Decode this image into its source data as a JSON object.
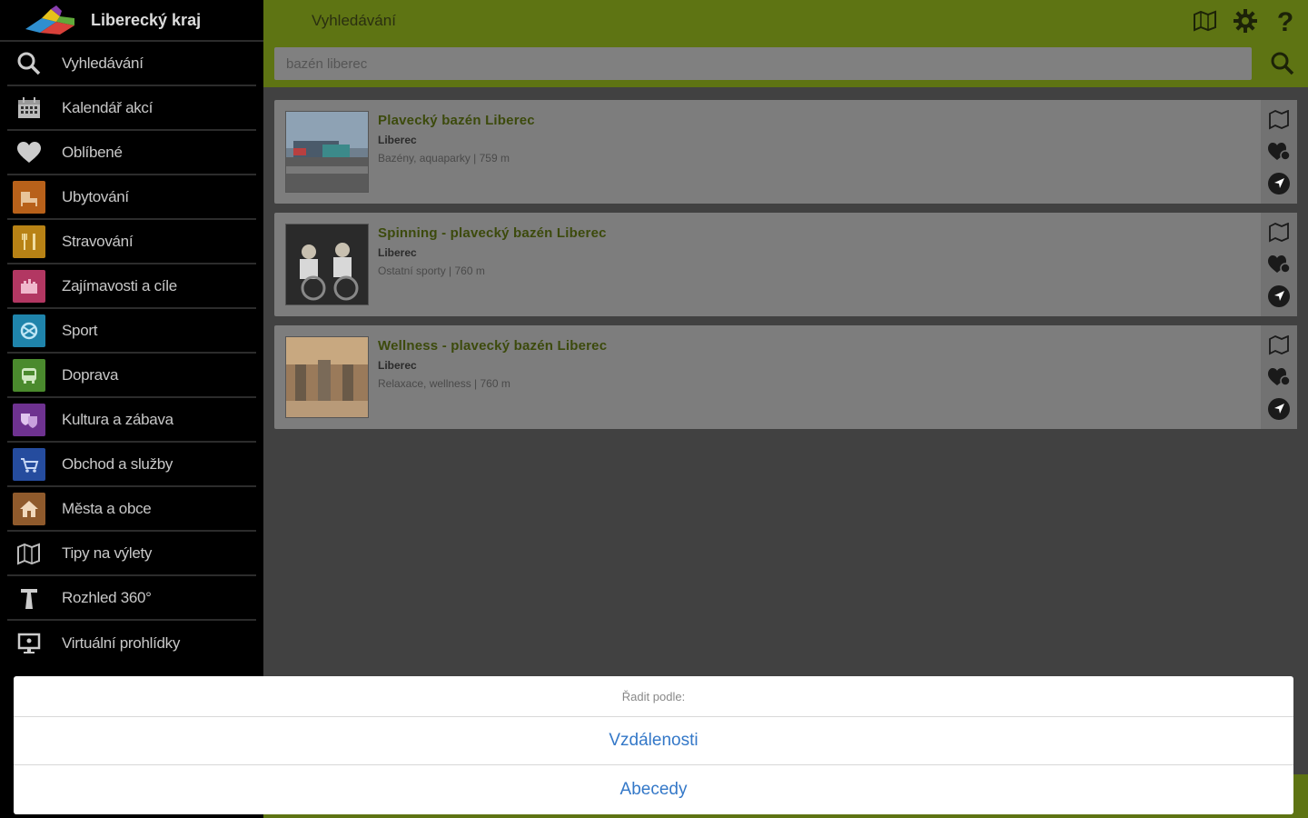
{
  "sidebar": {
    "title": "Liberecký kraj",
    "items": [
      {
        "label": "Vyhledávání",
        "icon": "search-icon",
        "color": ""
      },
      {
        "label": "Kalendář akcí",
        "icon": "calendar-icon",
        "color": ""
      },
      {
        "label": "Oblíbené",
        "icon": "heart-icon",
        "color": ""
      },
      {
        "label": "Ubytování",
        "icon": "bed-icon",
        "color": "#e07a1f"
      },
      {
        "label": "Stravování",
        "icon": "cutlery-icon",
        "color": "#e6a51c"
      },
      {
        "label": "Zajímavosti a cíle",
        "icon": "castle-icon",
        "color": "#e0457b"
      },
      {
        "label": "Sport",
        "icon": "sport-icon",
        "color": "#2aa6d6"
      },
      {
        "label": "Doprava",
        "icon": "bus-icon",
        "color": "#5faa3a"
      },
      {
        "label": "Kultura a zábava",
        "icon": "theater-icon",
        "color": "#8a3fb0"
      },
      {
        "label": "Obchod a služby",
        "icon": "shop-icon",
        "color": "#2f5fc4"
      },
      {
        "label": "Města a obce",
        "icon": "house-icon",
        "color": "#b5733a"
      },
      {
        "label": "Tipy na výlety",
        "icon": "map-icon",
        "color": ""
      },
      {
        "label": "Rozhled 360°",
        "icon": "tower-icon",
        "color": ""
      },
      {
        "label": "Virtuální prohlídky",
        "icon": "monitor-icon",
        "color": ""
      }
    ]
  },
  "header": {
    "title": "Vyhledávání"
  },
  "search": {
    "value": "bazén liberec"
  },
  "results": [
    {
      "title": "Plavecký bazén Liberec",
      "city": "Liberec",
      "subtitle": "Bazény, aquaparky | 759 m"
    },
    {
      "title": "Spinning - plavecký bazén Liberec",
      "city": "Liberec",
      "subtitle": "Ostatní sporty | 760 m"
    },
    {
      "title": "Wellness - plavecký bazén Liberec",
      "city": "Liberec",
      "subtitle": "Relaxace, wellness | 760 m"
    }
  ],
  "sheet": {
    "title": "Řadit podle:",
    "options": [
      "Vzdálenosti",
      "Abecedy"
    ]
  },
  "colors": {
    "accent": "#5e7413",
    "link": "#3478c8"
  }
}
